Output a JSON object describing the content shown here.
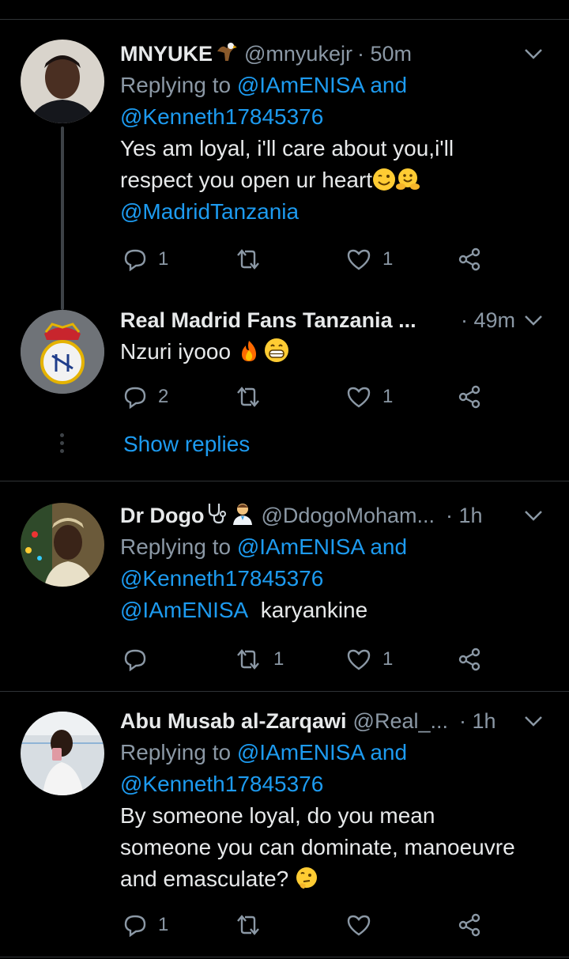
{
  "tweets": [
    {
      "name": "MNYUKE",
      "name_emoji": "🦅",
      "handle": "@mnyukejr",
      "time": "50m",
      "replying_prefix": "Replying to",
      "replying_user1": "@IAmENISA",
      "replying_and": "and",
      "replying_user2": "@Kenneth17845376",
      "text_line1": "Yes  am loyal, i'll care about you,i'll",
      "text_line2": "respect you open ur heart",
      "mention": "@MadridTanzania",
      "replies": "1",
      "retweets": "",
      "likes": "1"
    },
    {
      "name": "Real Madrid Fans Tanzania ...",
      "time": "· 49m",
      "text": "Nzuri iyooo",
      "replies": "2",
      "retweets": "",
      "likes": "1",
      "show_replies": "Show replies"
    },
    {
      "name": "Dr Dogo",
      "handle": "@DdogoMoham...",
      "time": "· 1h",
      "replying_prefix": "Replying to",
      "replying_user1": "@IAmENISA",
      "replying_and": "and",
      "replying_user2": "@Kenneth17845376",
      "mention": "@IAmENISA",
      "text": "karyankine",
      "replies": "",
      "retweets": "1",
      "likes": "1"
    },
    {
      "name": "Abu Musab al-Zarqawi",
      "handle": "@Real_...",
      "time": "· 1h",
      "replying_prefix": "Replying to",
      "replying_user1": "@IAmENISA",
      "replying_and": "and",
      "replying_user2": "@Kenneth17845376",
      "text_line1": "By someone loyal, do you mean",
      "text_line2": "someone you can dominate, manoeuvre",
      "text_line3": "and emasculate?",
      "replies": "1",
      "retweets": "",
      "likes": ""
    }
  ],
  "colors": {
    "background": "#000000",
    "link": "#1d9bf0",
    "muted": "#8b98a5",
    "divider": "#2f3336"
  }
}
